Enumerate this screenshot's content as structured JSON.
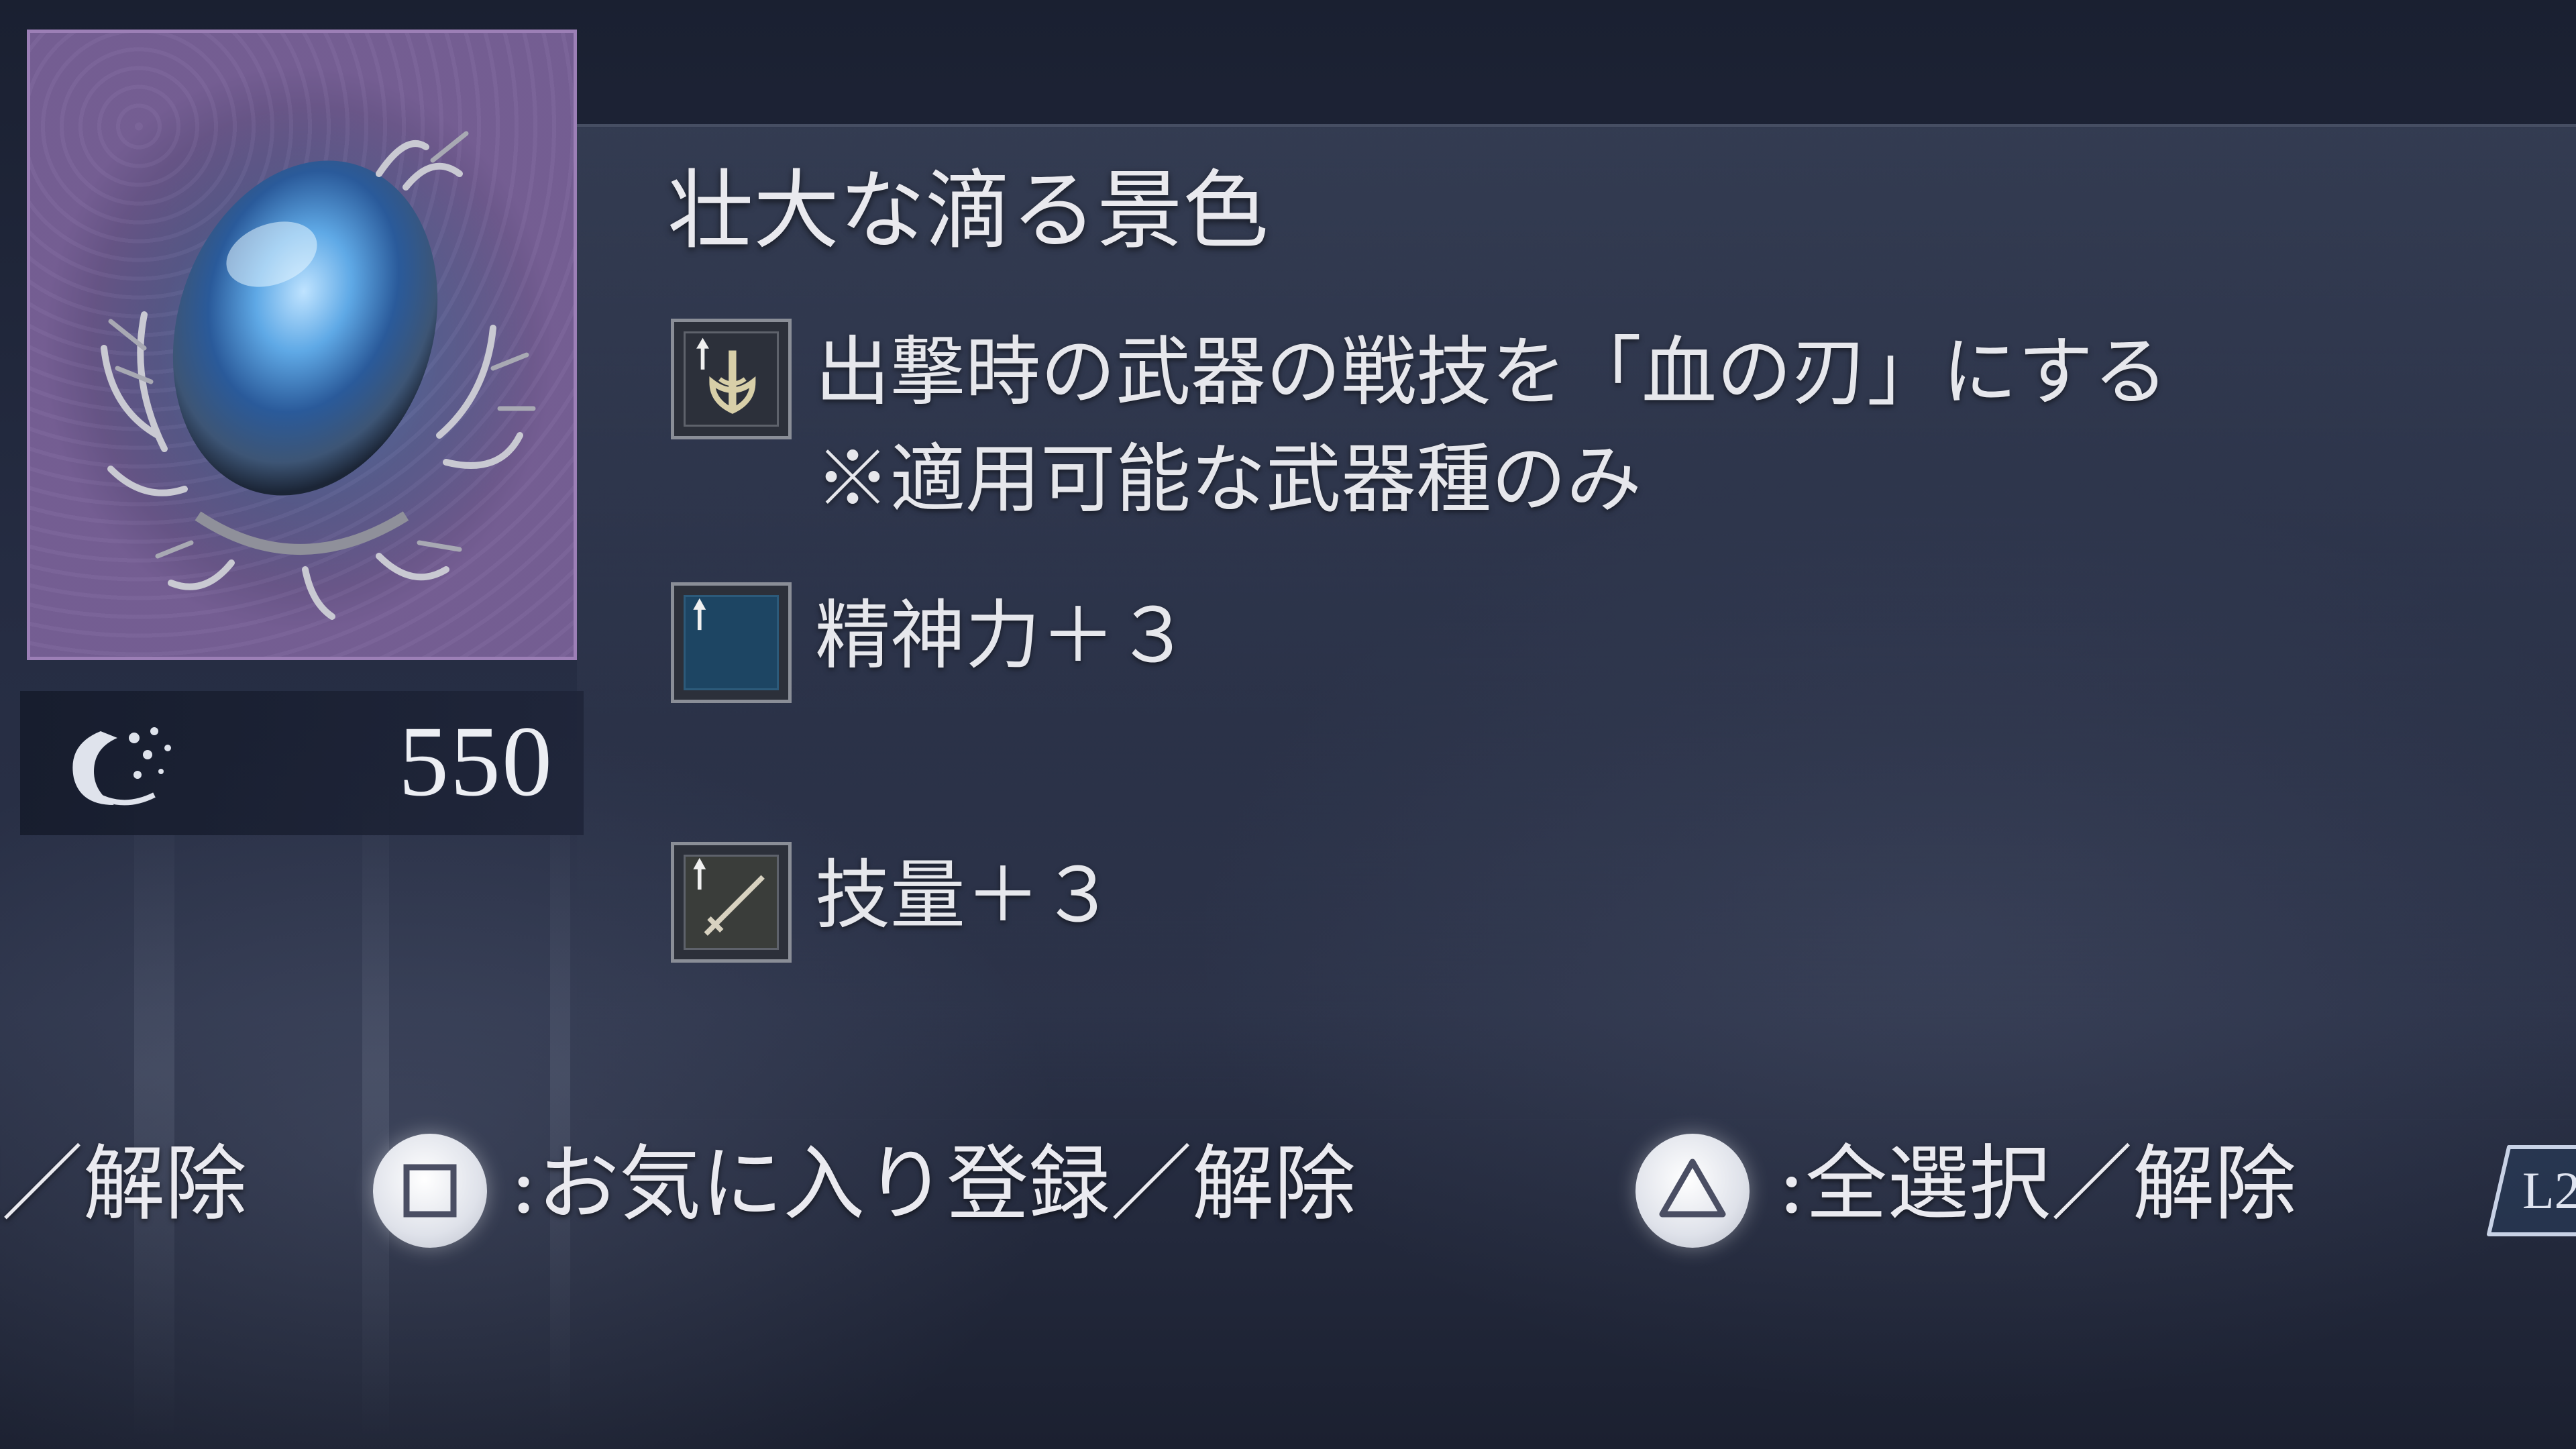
{
  "relic": {
    "title": "壮大な滴る景色",
    "cost": "550",
    "cost_icon": "murk-icon",
    "image": "relic-stone-icon"
  },
  "effects": [
    {
      "icon": "blood-blade-skill-icon",
      "line1": "出撃時の武器の戦技を「血の刃」にする",
      "line2": "※適用可能な武器種のみ"
    },
    {
      "icon": "mind-stat-icon",
      "line1": "精神力＋３"
    },
    {
      "icon": "dexterity-stat-icon",
      "line1": "技量＋３"
    }
  ],
  "footer": {
    "cut_left_label": "択／解除",
    "square_label": ":お気に入り登録／解除",
    "triangle_label": ":全選択／解除",
    "l2_label": "L2"
  },
  "colors": {
    "frame_accent": "#9c7fb6",
    "background": "#1e2436",
    "text": "#e6e7ec"
  }
}
